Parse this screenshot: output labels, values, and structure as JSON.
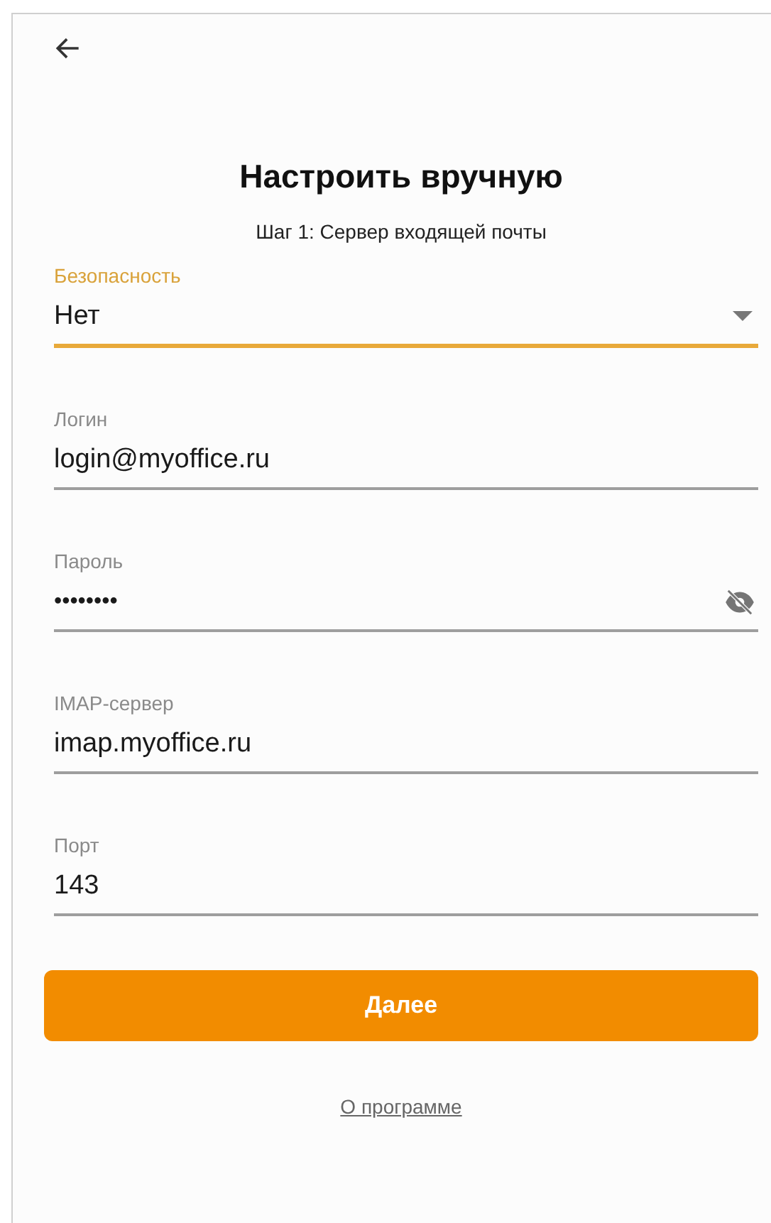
{
  "header": {
    "title": "Настроить вручную",
    "subtitle": "Шаг 1: Сервер входящей почты"
  },
  "fields": [
    {
      "kind": "select",
      "label": "Безопасность",
      "value": "Нет",
      "focused": true
    },
    {
      "kind": "text",
      "label": "Логин",
      "value": "login@myoffice.ru",
      "focused": false
    },
    {
      "kind": "password",
      "label": "Пароль",
      "value": "••••••••",
      "focused": false,
      "revealed": false
    },
    {
      "kind": "text",
      "label": "IMAP-сервер",
      "value": "imap.myoffice.ru",
      "focused": false
    },
    {
      "kind": "text",
      "label": "Порт",
      "value": "143",
      "focused": false
    }
  ],
  "next_button": "Далее",
  "about_link": "О программе"
}
